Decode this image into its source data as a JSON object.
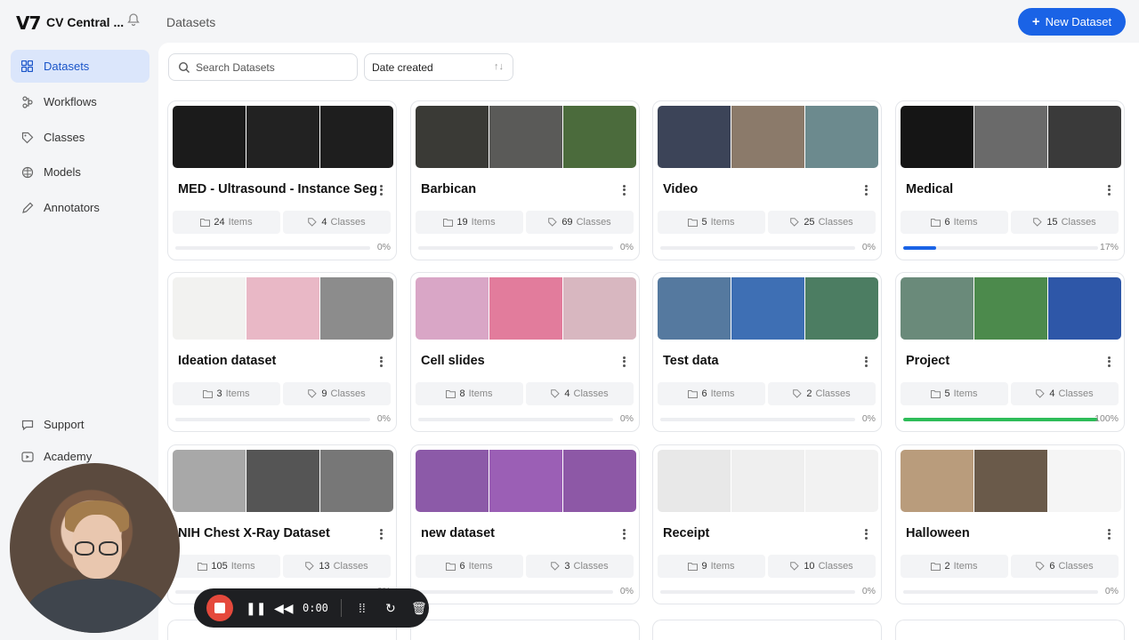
{
  "header": {
    "logo": "V7",
    "workspace": "CV Central ...",
    "breadcrumb": "Datasets",
    "new_dataset_label": "New Dataset"
  },
  "sidebar": {
    "items": [
      {
        "label": "Datasets",
        "icon": "grid-icon",
        "active": true
      },
      {
        "label": "Workflows",
        "icon": "workflow-icon"
      },
      {
        "label": "Classes",
        "icon": "tag-icon"
      },
      {
        "label": "Models",
        "icon": "brain-icon"
      },
      {
        "label": "Annotators",
        "icon": "pen-icon"
      }
    ],
    "bottom": [
      {
        "label": "Support",
        "icon": "chat-icon"
      },
      {
        "label": "Academy",
        "icon": "play-icon"
      }
    ]
  },
  "toolbar": {
    "search_placeholder": "Search Datasets",
    "sort_label": "Date created"
  },
  "datasets": [
    {
      "name": "MED - Ultrasound - Instance Seg",
      "items": "24",
      "classes": "4",
      "progress": "0%",
      "progress_value": 0,
      "colors": [
        "#1b1b1b",
        "#222",
        "#1e1e1e"
      ]
    },
    {
      "name": "Barbican",
      "items": "19",
      "classes": "69",
      "progress": "0%",
      "progress_value": 0,
      "colors": [
        "#3a3a36",
        "#5a5a58",
        "#4b6b3c"
      ]
    },
    {
      "name": "Video",
      "items": "5",
      "classes": "25",
      "progress": "0%",
      "progress_value": 0,
      "colors": [
        "#3c4458",
        "#8b7a6a",
        "#6c8a8e"
      ]
    },
    {
      "name": "Medical",
      "items": "6",
      "classes": "15",
      "progress": "17%",
      "progress_value": 17,
      "colors": [
        "#151515",
        "#6a6a6a",
        "#3a3a3a"
      ]
    },
    {
      "name": "Ideation dataset",
      "items": "3",
      "classes": "9",
      "progress": "0%",
      "progress_value": 0,
      "colors": [
        "#f2f2f0",
        "#e9b8c6",
        "#8c8c8c"
      ]
    },
    {
      "name": "Cell slides",
      "items": "8",
      "classes": "4",
      "progress": "0%",
      "progress_value": 0,
      "colors": [
        "#d9a6c6",
        "#e27c9c",
        "#d8b7c0"
      ]
    },
    {
      "name": "Test data",
      "items": "6",
      "classes": "2",
      "progress": "0%",
      "progress_value": 0,
      "colors": [
        "#55799f",
        "#3e6fb4",
        "#4c7d62"
      ]
    },
    {
      "name": "Project",
      "items": "5",
      "classes": "4",
      "progress": "100%",
      "progress_value": 100,
      "colors": [
        "#6a8a7a",
        "#4c8a4c",
        "#2e57a8"
      ]
    },
    {
      "name": "NIH Chest X-Ray Dataset",
      "items": "105",
      "classes": "13",
      "progress": "0%",
      "progress_value": 0,
      "colors": [
        "#a8a8a8",
        "#555",
        "#777"
      ]
    },
    {
      "name": "new dataset",
      "items": "6",
      "classes": "3",
      "progress": "0%",
      "progress_value": 0,
      "colors": [
        "#8c5aa8",
        "#9b5fb5",
        "#8d58a6"
      ]
    },
    {
      "name": "Receipt",
      "items": "9",
      "classes": "10",
      "progress": "0%",
      "progress_value": 0,
      "colors": [
        "#e8e8e8",
        "#efefef",
        "#f2f2f2"
      ]
    },
    {
      "name": "Halloween",
      "items": "2",
      "classes": "6",
      "progress": "0%",
      "progress_value": 0,
      "colors": [
        "#b99c7c",
        "#6a5a4a",
        "#f5f5f5"
      ]
    }
  ],
  "labels": {
    "items": "Items",
    "classes": "Classes"
  },
  "recorder": {
    "time": "0:00"
  },
  "colors": {
    "accent": "#1a63e6",
    "progress_blue": "#1a63e6",
    "progress_green": "#2ebd59"
  }
}
